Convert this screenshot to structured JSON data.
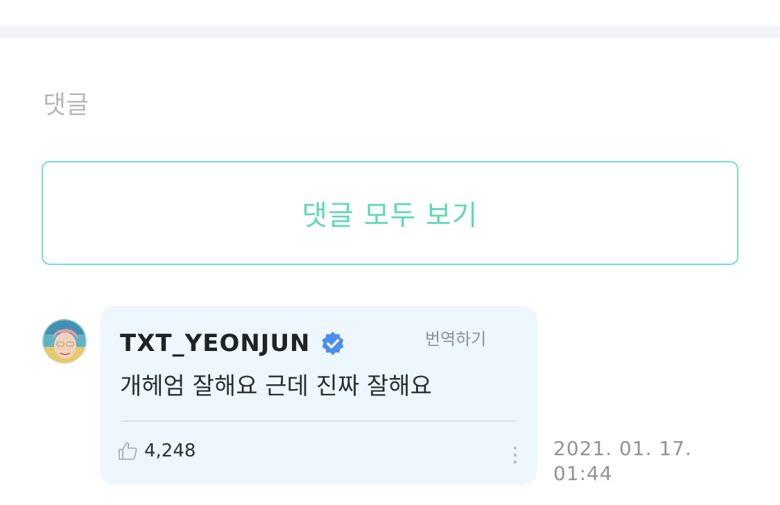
{
  "section": {
    "title": "댓글"
  },
  "view_all": {
    "label": "댓글 모두 보기"
  },
  "comment": {
    "author": "TXT_YEONJUN",
    "verified_icon": "verified-badge-icon",
    "translate_label": "번역하기",
    "text": "개헤엄 잘해요 근데 진짜 잘해요",
    "likes": "4,248",
    "timestamp": "2021. 01. 17. 01:44"
  },
  "colors": {
    "accent": "#5ed8b9",
    "card_bg": "#eef7fd",
    "verified": "#4a8eed"
  }
}
